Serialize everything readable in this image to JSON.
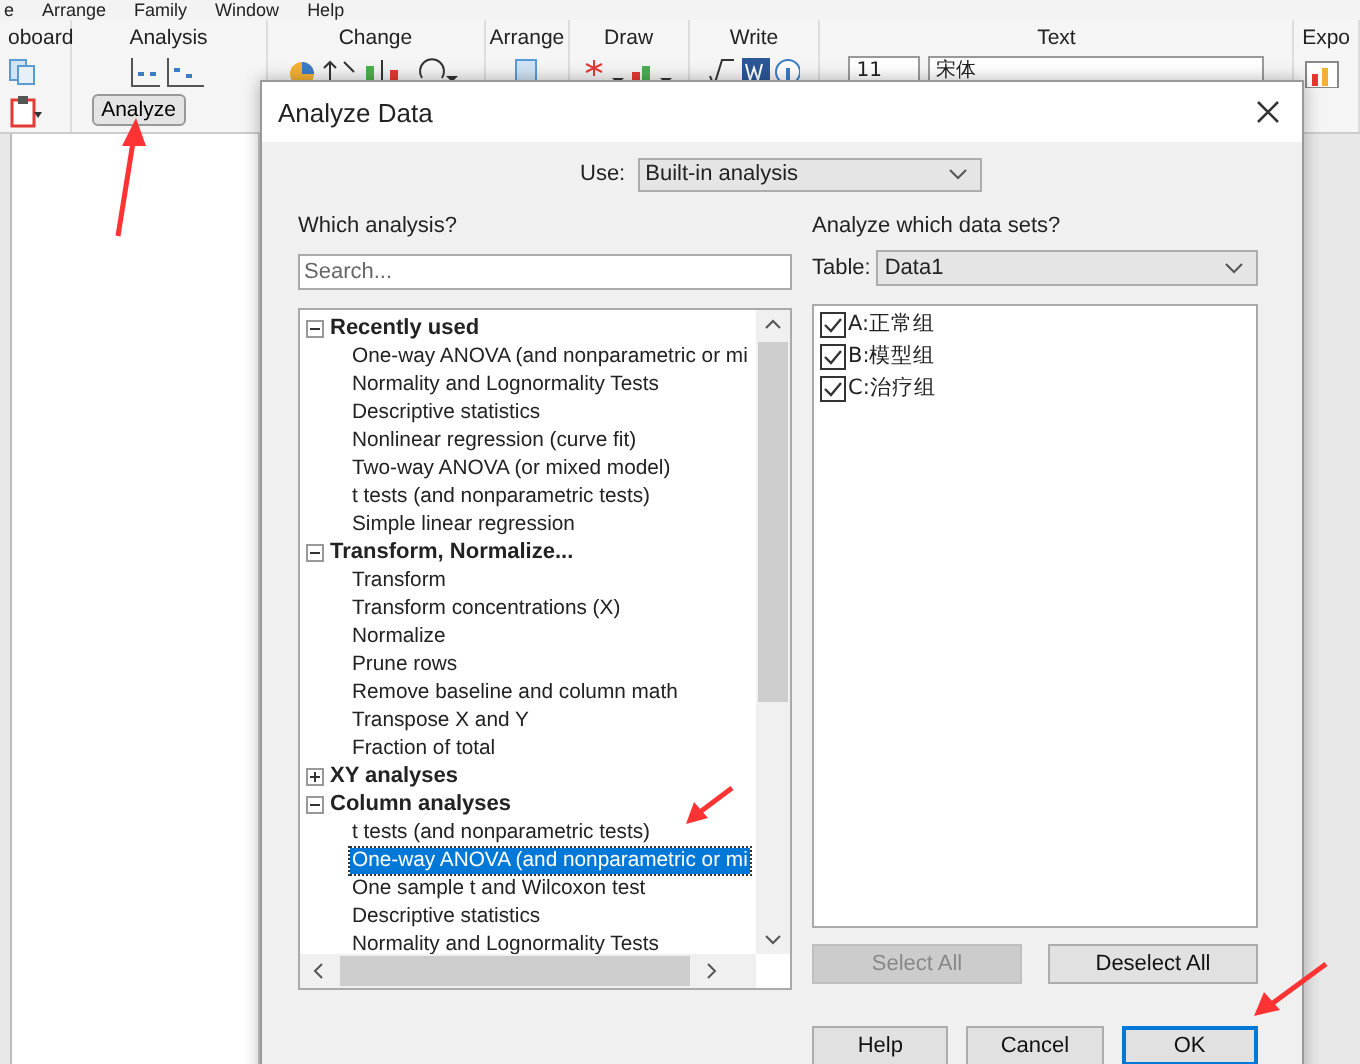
{
  "menu": [
    "e",
    "Arrange",
    "Family",
    "Window",
    "Help"
  ],
  "ribbon": {
    "groups": [
      {
        "label": "oboard",
        "kind": "clipboard"
      },
      {
        "label": "Analysis",
        "kind": "analysis"
      },
      {
        "label": "Change",
        "kind": "change"
      },
      {
        "label": "Arrange",
        "kind": "arrange"
      },
      {
        "label": "Draw",
        "kind": "draw"
      },
      {
        "label": "Write",
        "kind": "write"
      },
      {
        "label": "Text",
        "kind": "text"
      },
      {
        "label": "Expo",
        "kind": "export"
      }
    ],
    "analyze_button": "Analyze",
    "font_size": "11",
    "font_name": "宋体"
  },
  "dialog": {
    "title": "Analyze Data",
    "use_label": "Use:",
    "use_value": "Built-in analysis",
    "which_label": "Which analysis?",
    "search": {
      "placeholder": "Search..."
    },
    "tree": [
      {
        "label": "Recently used",
        "expanded": true,
        "children": [
          {
            "label": "One-way ANOVA (and nonparametric or mi",
            "selected": false
          },
          {
            "label": "Normality and Lognormality Tests",
            "selected": false
          },
          {
            "label": "Descriptive statistics",
            "selected": false
          },
          {
            "label": "Nonlinear regression (curve fit)",
            "selected": false
          },
          {
            "label": "Two-way ANOVA (or mixed model)",
            "selected": false
          },
          {
            "label": "t tests (and nonparametric tests)",
            "selected": false
          },
          {
            "label": "Simple linear regression",
            "selected": false
          }
        ]
      },
      {
        "label": "Transform, Normalize...",
        "expanded": true,
        "children": [
          {
            "label": "Transform",
            "selected": false
          },
          {
            "label": "Transform concentrations (X)",
            "selected": false
          },
          {
            "label": "Normalize",
            "selected": false
          },
          {
            "label": "Prune rows",
            "selected": false
          },
          {
            "label": "Remove baseline and column math",
            "selected": false
          },
          {
            "label": "Transpose X and Y",
            "selected": false
          },
          {
            "label": "Fraction of total",
            "selected": false
          }
        ]
      },
      {
        "label": "XY analyses",
        "expanded": false
      },
      {
        "label": "Column analyses",
        "expanded": true,
        "children": [
          {
            "label": "t tests (and nonparametric tests)",
            "selected": false
          },
          {
            "label": "One-way ANOVA (and nonparametric or mi",
            "selected": true
          },
          {
            "label": "One sample t and Wilcoxon test",
            "selected": false
          },
          {
            "label": "Descriptive statistics",
            "selected": false
          },
          {
            "label": "Normality and Lognormality Tests",
            "selected": false
          }
        ]
      }
    ],
    "datasets_label": "Analyze which data sets?",
    "table_label": "Table:",
    "table_value": "Data1",
    "datasets": [
      {
        "label": "A:正常组",
        "checked": true
      },
      {
        "label": "B:模型组",
        "checked": true
      },
      {
        "label": "C:治疗组",
        "checked": true
      }
    ],
    "select_all": {
      "label": "Select All",
      "disabled": true
    },
    "deselect_all": {
      "label": "Deselect All",
      "disabled": false
    },
    "buttons": [
      {
        "label": "Help",
        "focused": false
      },
      {
        "label": "Cancel",
        "focused": false
      },
      {
        "label": "OK",
        "focused": true
      }
    ]
  }
}
